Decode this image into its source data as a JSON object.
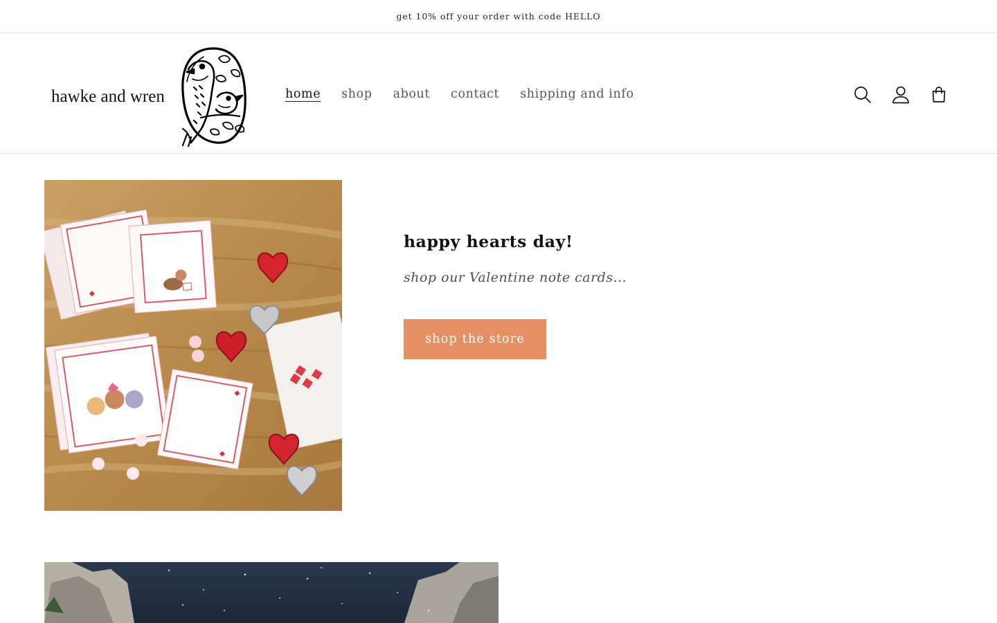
{
  "announcement": {
    "text": "get 10% off your order with code HELLO"
  },
  "header": {
    "logo_text": "hawke and wren",
    "nav": [
      {
        "label": "home",
        "active": true
      },
      {
        "label": "shop",
        "active": false
      },
      {
        "label": "about",
        "active": false
      },
      {
        "label": "contact",
        "active": false
      },
      {
        "label": "shipping and info",
        "active": false
      }
    ],
    "icons": [
      "search-icon",
      "account-icon",
      "cart-icon"
    ]
  },
  "hero": {
    "title": "happy hearts day!",
    "subtitle": "shop our Valentine note cards...",
    "button_label": "shop the store",
    "image": "valentine-note-cards-photo"
  },
  "second_section": {
    "image": "night-sky-mountains-artwork"
  },
  "colors": {
    "accent_button": "#e58f64",
    "text": "#121212",
    "border": "#e6e6e6"
  }
}
